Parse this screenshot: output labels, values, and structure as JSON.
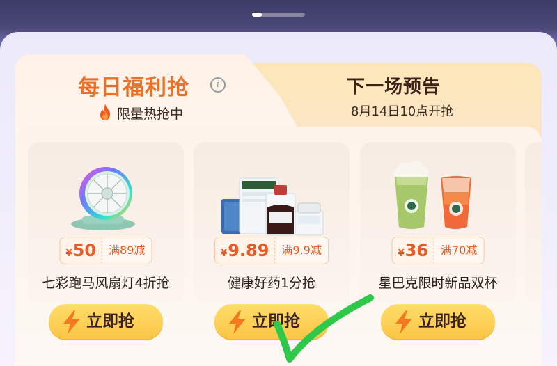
{
  "header": {
    "pager": {
      "total": 2,
      "active": 0
    }
  },
  "tabs": {
    "active": {
      "title": "每日福利抢",
      "info_icon": "info-icon",
      "subtitle": "限量热抢中",
      "subtitle_icon": "fire-icon"
    },
    "next": {
      "title": "下一场预告",
      "time": "8月14日10点开抢"
    }
  },
  "products": [
    {
      "name": "七彩跑马风扇灯4折抢",
      "yen": "¥",
      "price": "50",
      "coupon": "满89减",
      "button": "立即抢",
      "image_icon": "fan-lamp-image"
    },
    {
      "name": "健康好药1分抢",
      "yen": "¥",
      "price": "9.89",
      "coupon": "满9.9减",
      "button": "立即抢",
      "image_icon": "medicine-image"
    },
    {
      "name": "星巴克限时新品双杯",
      "yen": "¥",
      "price": "36",
      "coupon": "满70减",
      "button": "立即抢",
      "image_icon": "starbucks-cups-image"
    }
  ],
  "colors": {
    "accent_orange": "#e9722a",
    "price_red": "#ea5a24",
    "button_yellow": "#fbc545",
    "check_green": "#2fc94a"
  }
}
